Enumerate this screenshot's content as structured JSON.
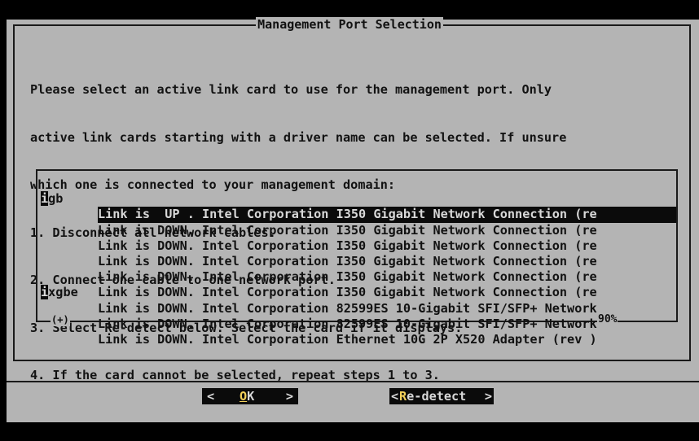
{
  "dialog": {
    "title": "Management Port Selection",
    "instructions": [
      "Please select an active link card to use for the management port. Only",
      "active link cards starting with a driver name can be selected. If unsure",
      "which one is connected to your management domain:",
      "1. Disconnect all network cables.",
      "2. Connect one cable to one network port.",
      "3. Select Re-detect below. Select the card if it displays.",
      "4. If the card cannot be selected, repeat steps 1 to 3."
    ]
  },
  "list": {
    "rows": [
      {
        "driver_hotkey": "i",
        "driver_rest": "gb",
        "desc": "Link is  UP . Intel Corporation I350 Gigabit Network Connection (re"
      },
      {
        "driver_hotkey": "",
        "driver_rest": "",
        "desc": "Link is DOWN. Intel Corporation I350 Gigabit Network Connection (re"
      },
      {
        "driver_hotkey": "",
        "driver_rest": "",
        "desc": "Link is DOWN. Intel Corporation I350 Gigabit Network Connection (re"
      },
      {
        "driver_hotkey": "",
        "driver_rest": "",
        "desc": "Link is DOWN. Intel Corporation I350 Gigabit Network Connection (re"
      },
      {
        "driver_hotkey": "",
        "driver_rest": "",
        "desc": "Link is DOWN. Intel Corporation I350 Gigabit Network Connection (re"
      },
      {
        "driver_hotkey": "",
        "driver_rest": "",
        "desc": "Link is DOWN. Intel Corporation I350 Gigabit Network Connection (re"
      },
      {
        "driver_hotkey": "i",
        "driver_rest": "xgbe",
        "desc": "Link is DOWN. Intel Corporation 82599ES 10-Gigabit SFI/SFP+ Network"
      },
      {
        "driver_hotkey": "",
        "driver_rest": "",
        "desc": "Link is DOWN. Intel Corporation 82599ES 10-Gigabit SFI/SFP+ Network"
      },
      {
        "driver_hotkey": "",
        "driver_rest": "",
        "desc": "Link is DOWN. Intel Corporation Ethernet 10G 2P X520 Adapter (rev )"
      }
    ],
    "scroll_indicator": "(+)",
    "scroll_percent": "90%"
  },
  "buttons": {
    "ok": {
      "lt": "<",
      "hotkey": "O",
      "rest": "K",
      "gt": ">"
    },
    "redetect": {
      "lt": "<",
      "hotkey": "R",
      "rest": "e-detect",
      "gt": ">"
    }
  },
  "colors": {
    "dialog_bg": "#b4b4b4",
    "screen_bg": "#000000",
    "selection_bg": "#0b0b0b",
    "hotkey_fg": "#f2d05a"
  }
}
